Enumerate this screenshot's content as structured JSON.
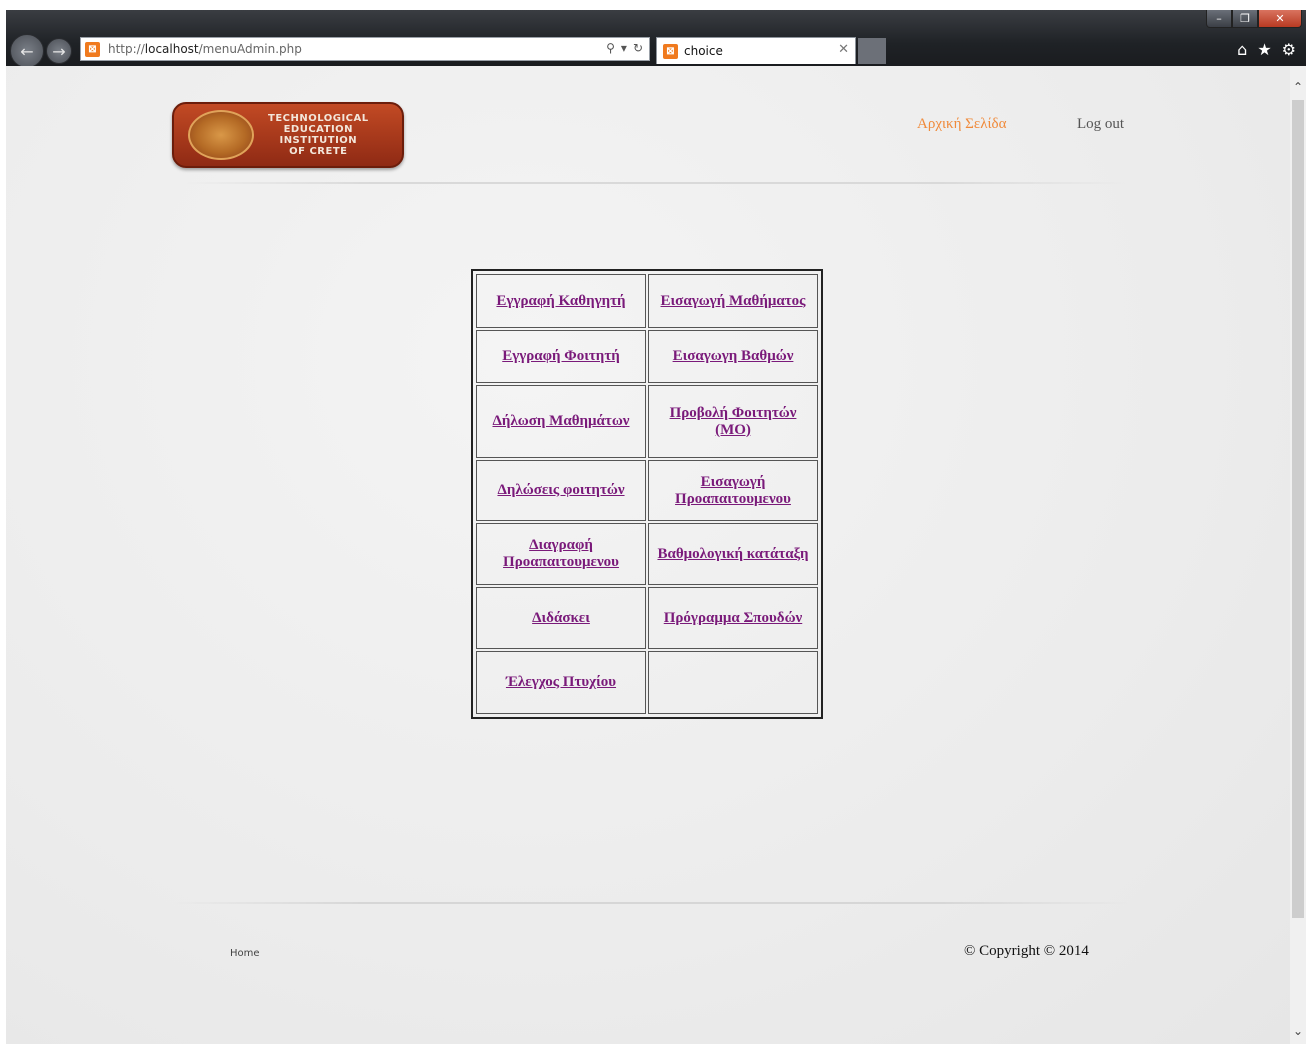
{
  "browser": {
    "url_prefix": "http://",
    "url_host": "localhost",
    "url_path": "/menuAdmin.php",
    "tab_title": "choice",
    "window_controls": {
      "minimize": "–",
      "restore": "❐",
      "close": "✕"
    }
  },
  "header": {
    "logo_text": [
      "TECHNOLOGICAL",
      "EDUCATION",
      "INSTITUTION",
      "OF CRETE"
    ],
    "nav_home": "Αρχική Σελίδα",
    "nav_logout": "Log out"
  },
  "menu": {
    "rows": [
      [
        "Εγγραφή Καθηγητή",
        "Εισαγωγή Μαθήματος"
      ],
      [
        "Εγγραφή Φοιτητή",
        "Εισαγωγη Βαθμών"
      ],
      [
        "Δήλωση Μαθημάτων",
        "Προβολή Φοιτητών (ΜΟ)"
      ],
      [
        "Δηλώσεις φοιτητών",
        "Εισαγωγή Προαπαιτουμενου"
      ],
      [
        "Διαγραφή Προαπαιτουμενου",
        "Βαθμολογική κατάταξη"
      ],
      [
        "Διδάσκει",
        "Πρόγραμμα Σπουδών"
      ],
      [
        "Έλεγχος Πτυχίου",
        ""
      ]
    ]
  },
  "footer": {
    "home": "Home",
    "copyright": "© Copyright © 2014"
  },
  "colors": {
    "link": "#7a1a7a",
    "nav_home": "#f08a3a",
    "logo_bg": "#b03a1c"
  }
}
